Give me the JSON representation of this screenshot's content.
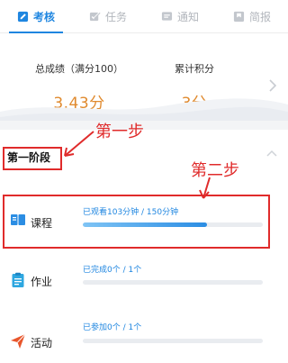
{
  "tabs": [
    {
      "label": "考核",
      "icon": "edit-icon",
      "active": true
    },
    {
      "label": "任务",
      "icon": "task-icon",
      "active": false
    },
    {
      "label": "通知",
      "icon": "message-icon",
      "active": false
    },
    {
      "label": "简报",
      "icon": "report-icon",
      "active": false
    }
  ],
  "scores": {
    "total_label": "总成绩（满分100）",
    "total_value": "3.43分",
    "points_label": "累计积分",
    "points_value": "3分"
  },
  "stage": {
    "title": "第一阶段"
  },
  "annotations": {
    "step1": "第一步",
    "step2": "第二步"
  },
  "rows": [
    {
      "name": "课程",
      "meta": "已观看103分钟 / 150分钟",
      "progress": 0.69,
      "icon": "course-book-icon"
    },
    {
      "name": "作业",
      "meta": "已完成0个 / 1个",
      "progress": 0,
      "icon": "homework-clipboard-icon"
    },
    {
      "name": "活动",
      "meta": "已参加0个 / 1个",
      "progress": 0,
      "icon": "activity-send-icon"
    }
  ],
  "colors": {
    "accent": "#1f86e0",
    "score": "#e08a2e",
    "annotation": "#e02b2b"
  }
}
